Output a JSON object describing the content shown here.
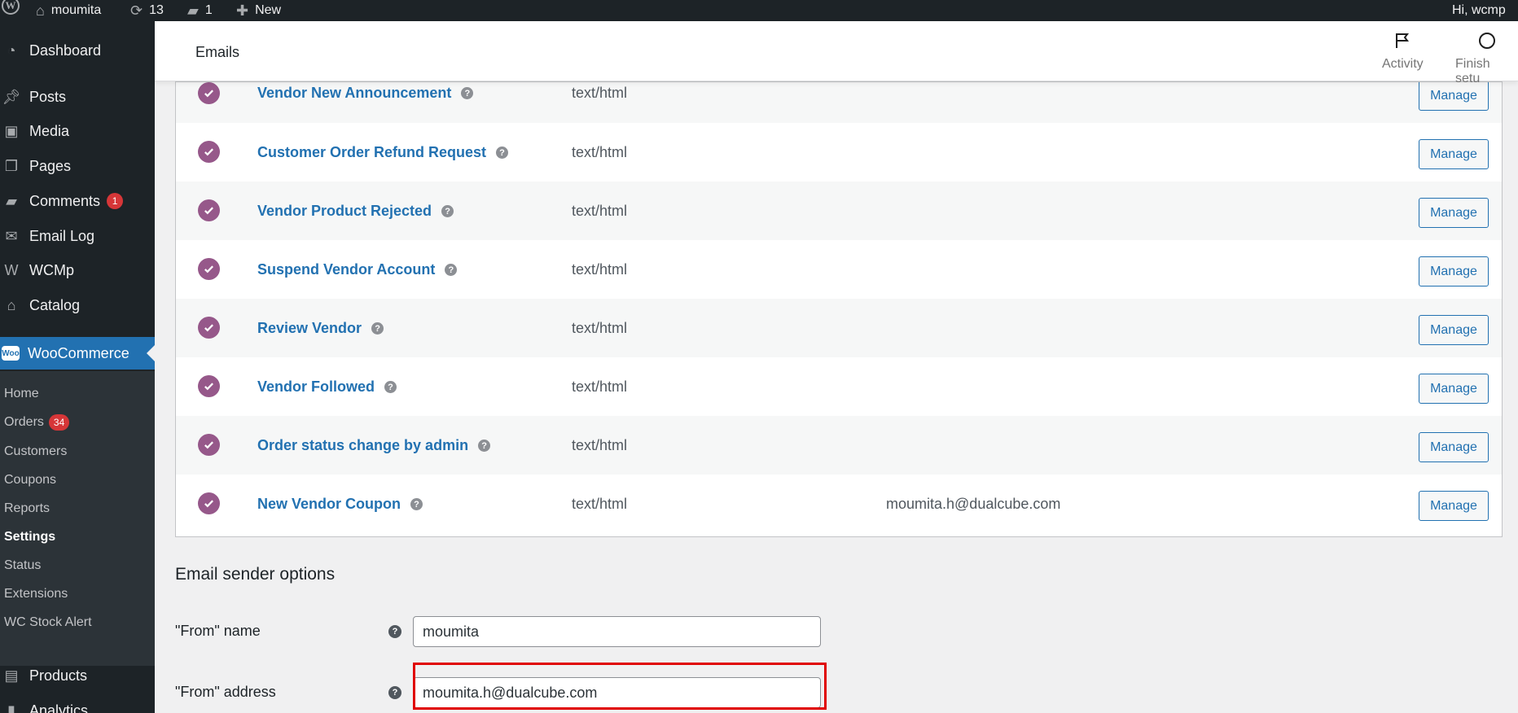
{
  "adminbar": {
    "site_name": "moumita",
    "updates_count": "13",
    "comments_count": "1",
    "new_label": "New",
    "greeting": "Hi, wcmp"
  },
  "sidebar": {
    "items": [
      {
        "label": "Dashboard",
        "icon": "dashboard-icon"
      },
      {
        "label": "Posts",
        "icon": "pushpin-icon"
      },
      {
        "label": "Media",
        "icon": "media-icon"
      },
      {
        "label": "Pages",
        "icon": "pages-icon"
      },
      {
        "label": "Comments",
        "icon": "comment-icon",
        "badge": "1"
      },
      {
        "label": "Email Log",
        "icon": "email-icon"
      },
      {
        "label": "WCMp",
        "icon": "wcmp-icon"
      },
      {
        "label": "Catalog",
        "icon": "store-icon"
      },
      {
        "label": "WooCommerce",
        "icon": "woo-icon"
      },
      {
        "label": "Products",
        "icon": "archive-icon"
      },
      {
        "label": "Analytics",
        "icon": "chart-icon"
      }
    ],
    "submenu": [
      {
        "label": "Home"
      },
      {
        "label": "Orders",
        "badge": "34"
      },
      {
        "label": "Customers"
      },
      {
        "label": "Coupons"
      },
      {
        "label": "Reports"
      },
      {
        "label": "Settings"
      },
      {
        "label": "Status"
      },
      {
        "label": "Extensions"
      },
      {
        "label": "WC Stock Alert"
      }
    ]
  },
  "header": {
    "title": "Emails",
    "activity_label": "Activity",
    "finish_setup_label": "Finish setu"
  },
  "emails": {
    "manage_label": "Manage",
    "rows": [
      {
        "name": "Vendor New Announcement",
        "type": "text/html",
        "recipient": ""
      },
      {
        "name": "Customer Order Refund Request",
        "type": "text/html",
        "recipient": ""
      },
      {
        "name": "Vendor Product Rejected",
        "type": "text/html",
        "recipient": ""
      },
      {
        "name": "Suspend Vendor Account",
        "type": "text/html",
        "recipient": ""
      },
      {
        "name": "Review Vendor",
        "type": "text/html",
        "recipient": ""
      },
      {
        "name": "Vendor Followed",
        "type": "text/html",
        "recipient": ""
      },
      {
        "name": "Order status change by admin",
        "type": "text/html",
        "recipient": ""
      },
      {
        "name": "New Vendor Coupon",
        "type": "text/html",
        "recipient": "moumita.h@dualcube.com"
      }
    ]
  },
  "sender_options": {
    "heading": "Email sender options",
    "from_name_label": "\"From\" name",
    "from_name_value": "moumita",
    "from_address_label": "\"From\" address",
    "from_address_value": "moumita.h@dualcube.com"
  },
  "colors": {
    "accent": "#2271b1",
    "check": "#96588a",
    "highlight": "#e00000",
    "badge": "#d63638"
  }
}
